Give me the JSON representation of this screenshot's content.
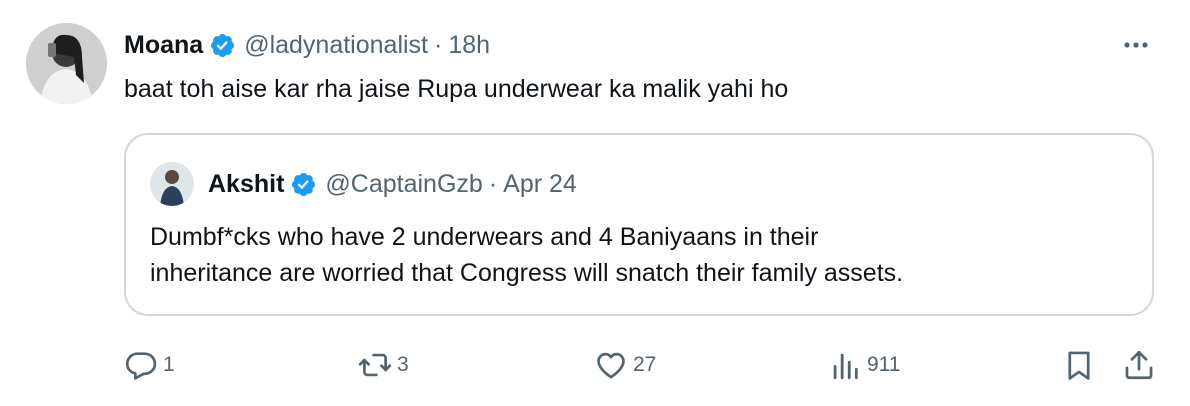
{
  "tweet": {
    "author_name": "Moana",
    "author_handle": "@ladynationalist",
    "time": "18h",
    "text": "baat toh aise kar rha jaise Rupa underwear ka malik yahi ho"
  },
  "quoted_tweet": {
    "author_name": "Akshit",
    "author_handle": "@CaptainGzb",
    "date": "Apr 24",
    "text_line1": "Dumbf*cks who have 2 underwears and 4 Baniyaans in their",
    "text_line2": "inheritance are worried that Congress will snatch their family assets."
  },
  "actions": {
    "replies": "1",
    "reposts": "3",
    "likes": "27",
    "views": "911"
  },
  "colors": {
    "verified_blue": "#1d9bf0",
    "secondary_text": "#536471",
    "border": "#cfd9de"
  },
  "icons": [
    "verified-badge-icon",
    "more-icon",
    "reply-icon",
    "repost-icon",
    "like-icon",
    "views-icon",
    "bookmark-icon",
    "share-icon"
  ]
}
